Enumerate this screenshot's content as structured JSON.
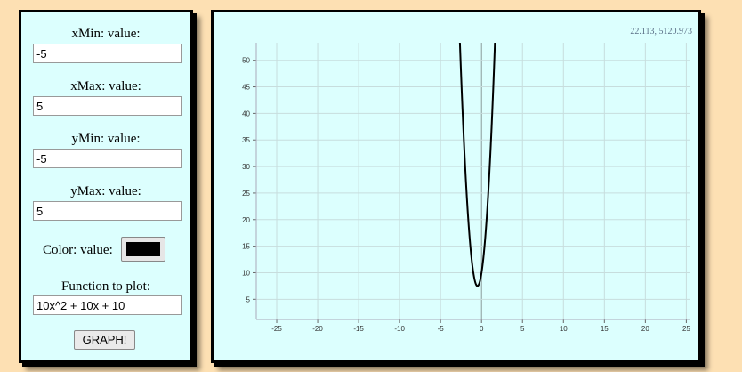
{
  "controls": {
    "xmin": {
      "label": "xMin: value:",
      "value": "-5"
    },
    "xmax": {
      "label": "xMax: value:",
      "value": "5"
    },
    "ymin": {
      "label": "yMin: value:",
      "value": "-5"
    },
    "ymax": {
      "label": "yMax: value:",
      "value": "5"
    },
    "color": {
      "label": "Color: value:",
      "value": "#000000"
    },
    "function": {
      "label": "Function to plot:",
      "value": "10x^2 + 10x + 10"
    },
    "graph_button": "GRAPH!"
  },
  "plot": {
    "coord_readout": "22.113, 5120.973"
  },
  "chart_data": {
    "type": "line",
    "title": "",
    "xlabel": "",
    "ylabel": "",
    "xlim": [
      -27.5,
      25.5
    ],
    "ylim": [
      1.2,
      53.3
    ],
    "x_ticks": [
      -25,
      -20,
      -15,
      -10,
      -5,
      0,
      5,
      10,
      15,
      20,
      25
    ],
    "y_ticks": [
      5,
      10,
      15,
      20,
      25,
      30,
      35,
      40,
      45,
      50
    ],
    "grid": true,
    "series": [
      {
        "function": "10x^2 + 10x + 10",
        "color": "#000000",
        "coefficients": {
          "a": 10,
          "b": 10,
          "c": 10
        }
      }
    ]
  }
}
